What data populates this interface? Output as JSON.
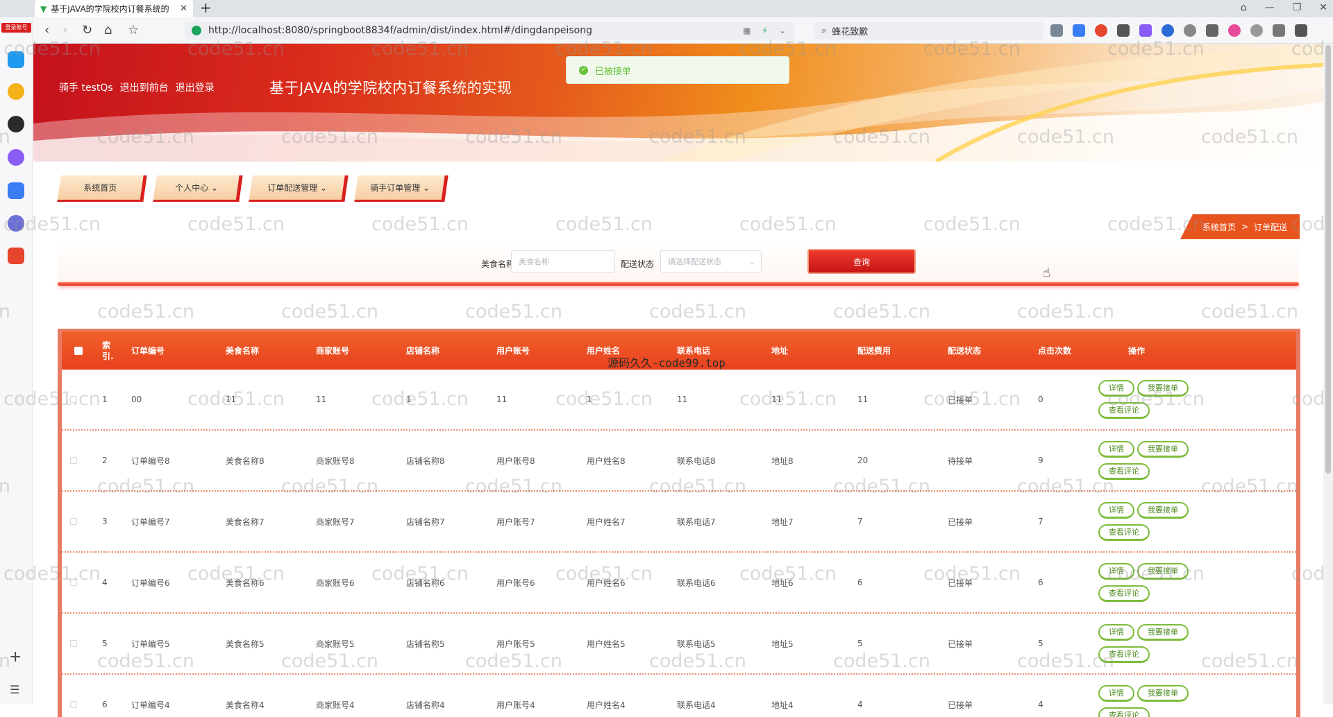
{
  "browser": {
    "tab_title": "基于JAVA的学院校内订餐系统的",
    "tab_close": "✕",
    "new_tab": "+",
    "url": "http://localhost:8080/springboot8834f/admin/dist/index.html#/dingdanpeisong",
    "search_text": "蜂花致歉",
    "login_badge": "登录账号"
  },
  "header": {
    "user_label": "骑手 testQs",
    "back_to_front": "退出到前台",
    "logout": "退出登录",
    "site_title": "基于JAVA的学院校内订餐系统的实现"
  },
  "toast": {
    "message": "已被接单",
    "icon": "✓"
  },
  "nav": {
    "items": [
      {
        "label": "系统首页"
      },
      {
        "label": "个人中心 ⌄"
      },
      {
        "label": "订单配送管理 ⌄"
      },
      {
        "label": "骑手订单管理 ⌄"
      }
    ]
  },
  "breadcrumb": {
    "home": "系统首页",
    "sep": ">",
    "current": "订单配送"
  },
  "search": {
    "food_label": "美食名称",
    "food_placeholder": "美食名称",
    "status_label": "配送状态",
    "status_placeholder": "请选择配送状态",
    "query_button": "查询"
  },
  "table": {
    "headers": {
      "index": "索引.",
      "order_no": "订单编号",
      "food": "美食名称",
      "merchant": "商家账号",
      "shop": "店铺名称",
      "user_acc": "用户账号",
      "user_name": "用户姓名",
      "phone": "联系电话",
      "address": "地址",
      "fee": "配送费用",
      "status": "配送状态",
      "clicks": "点击次数",
      "ops": "操作"
    },
    "rows": [
      [
        "1",
        "00",
        "11",
        "11",
        "1",
        "11",
        "1",
        "11",
        "11",
        "11",
        "已接单",
        "0"
      ],
      [
        "2",
        "订单编号8",
        "美食名称8",
        "商家账号8",
        "店铺名称8",
        "用户账号8",
        "用户姓名8",
        "联系电话8",
        "地址8",
        "20",
        "待接单",
        "9"
      ],
      [
        "3",
        "订单编号7",
        "美食名称7",
        "商家账号7",
        "店铺名称7",
        "用户账号7",
        "用户姓名7",
        "联系电话7",
        "地址7",
        "7",
        "已接单",
        "7"
      ],
      [
        "4",
        "订单编号6",
        "美食名称6",
        "商家账号6",
        "店铺名称6",
        "用户账号6",
        "用户姓名6",
        "联系电话6",
        "地址6",
        "6",
        "已接单",
        "6"
      ],
      [
        "5",
        "订单编号5",
        "美食名称5",
        "商家账号5",
        "店铺名称5",
        "用户账号5",
        "用户姓名5",
        "联系电话5",
        "地址5",
        "5",
        "已接单",
        "5"
      ],
      [
        "6",
        "订单编号4",
        "美食名称4",
        "商家账号4",
        "店铺名称4",
        "用户账号4",
        "用户姓名4",
        "联系电话4",
        "地址4",
        "4",
        "已接单",
        "4"
      ]
    ],
    "op_labels": {
      "detail": "详情",
      "accept": "我要接单",
      "comments": "查看评论"
    }
  },
  "watermark": {
    "site": "code51.cn",
    "center_text": "源码久久-code99.top"
  },
  "colors": {
    "accent_red": "#d9201e",
    "header_orange": "#e8401e",
    "op_green": "#7cbc3a",
    "toast_green": "#67c23a"
  }
}
